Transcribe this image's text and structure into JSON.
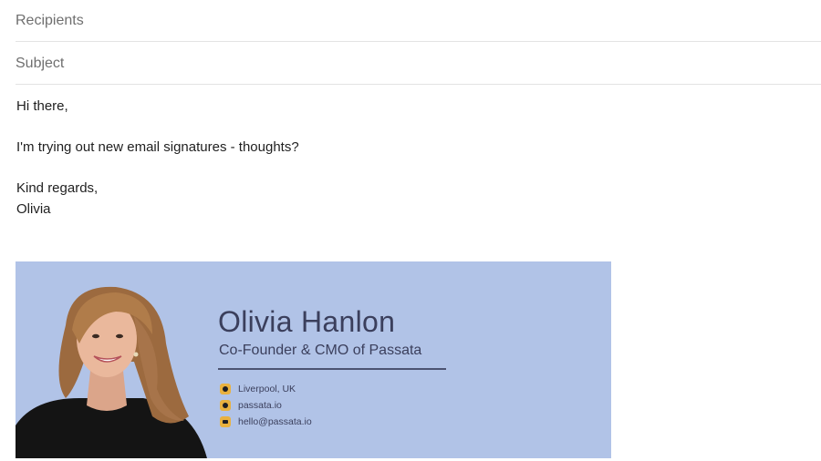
{
  "compose": {
    "recipients_placeholder": "Recipients",
    "subject_placeholder": "Subject"
  },
  "body": {
    "greeting": "Hi there,",
    "line1": "I'm trying out new email signatures - thoughts?",
    "closing": "Kind regards,",
    "sender": "Olivia"
  },
  "signature": {
    "name": "Olivia Hanlon",
    "title": "Co-Founder & CMO of Passata",
    "location": "Liverpool, UK",
    "website": "passata.io",
    "email": "hello@passata.io",
    "background_color": "#b1c3e7",
    "accent_color": "#e9b13f",
    "text_color": "#3b3f5c"
  }
}
